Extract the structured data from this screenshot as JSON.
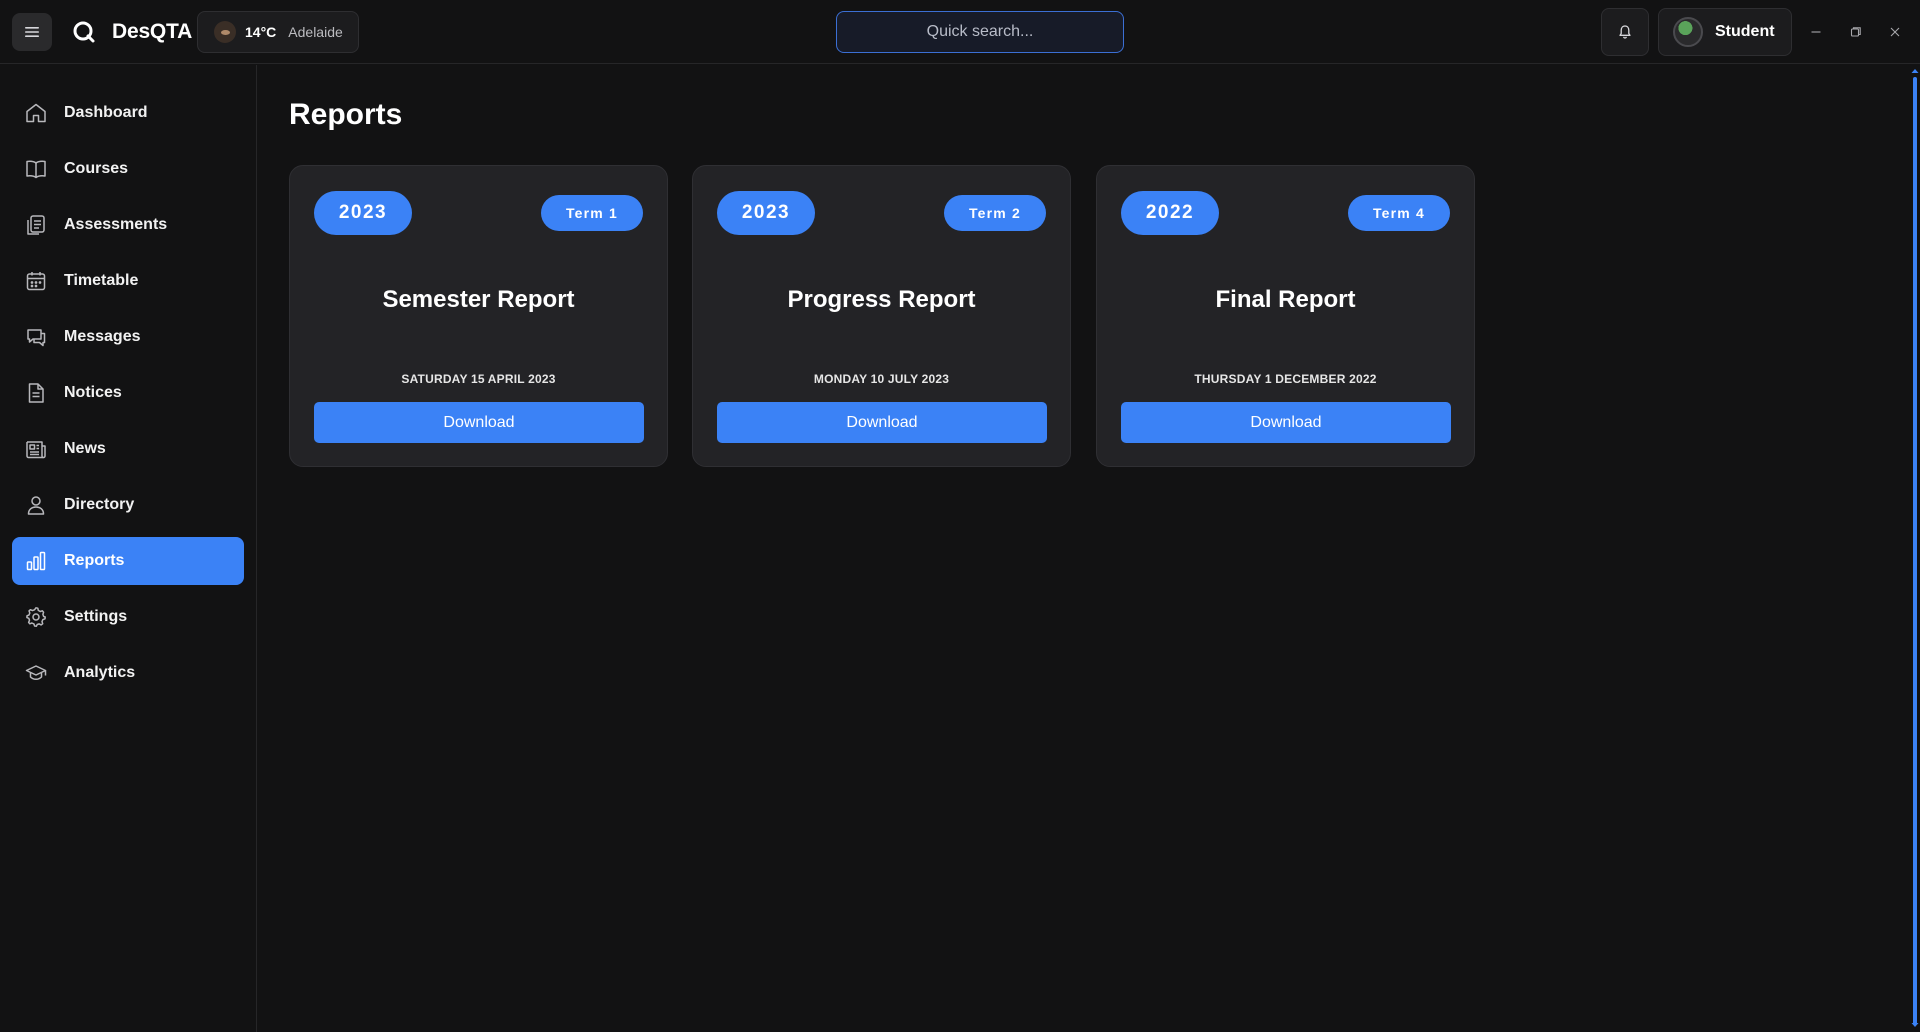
{
  "header": {
    "app_title": "DesQTA",
    "weather": {
      "temperature": "14°C",
      "city": "Adelaide"
    },
    "search": {
      "placeholder": "Quick search..."
    },
    "user": {
      "name": "Student"
    }
  },
  "sidebar": {
    "items": [
      {
        "label": "Dashboard",
        "icon": "home-icon"
      },
      {
        "label": "Courses",
        "icon": "book-icon"
      },
      {
        "label": "Assessments",
        "icon": "clipboard-icon"
      },
      {
        "label": "Timetable",
        "icon": "calendar-icon"
      },
      {
        "label": "Messages",
        "icon": "chat-icon"
      },
      {
        "label": "Notices",
        "icon": "document-icon"
      },
      {
        "label": "News",
        "icon": "newspaper-icon"
      },
      {
        "label": "Directory",
        "icon": "person-icon"
      },
      {
        "label": "Reports",
        "icon": "bar-chart-icon",
        "active": true
      },
      {
        "label": "Settings",
        "icon": "gear-icon"
      },
      {
        "label": "Analytics",
        "icon": "graduation-cap-icon"
      }
    ]
  },
  "main": {
    "title": "Reports",
    "reports": [
      {
        "year": "2023",
        "term": "Term 1",
        "title": "Semester Report",
        "date": "SATURDAY 15 APRIL 2023",
        "action": "Download"
      },
      {
        "year": "2023",
        "term": "Term 2",
        "title": "Progress Report",
        "date": "MONDAY 10 JULY 2023",
        "action": "Download"
      },
      {
        "year": "2022",
        "term": "Term 4",
        "title": "Final Report",
        "date": "THURSDAY 1 DECEMBER 2022",
        "action": "Download"
      }
    ]
  },
  "colors": {
    "accent": "#3b82f6",
    "background": "#121213",
    "card": "#232326"
  }
}
